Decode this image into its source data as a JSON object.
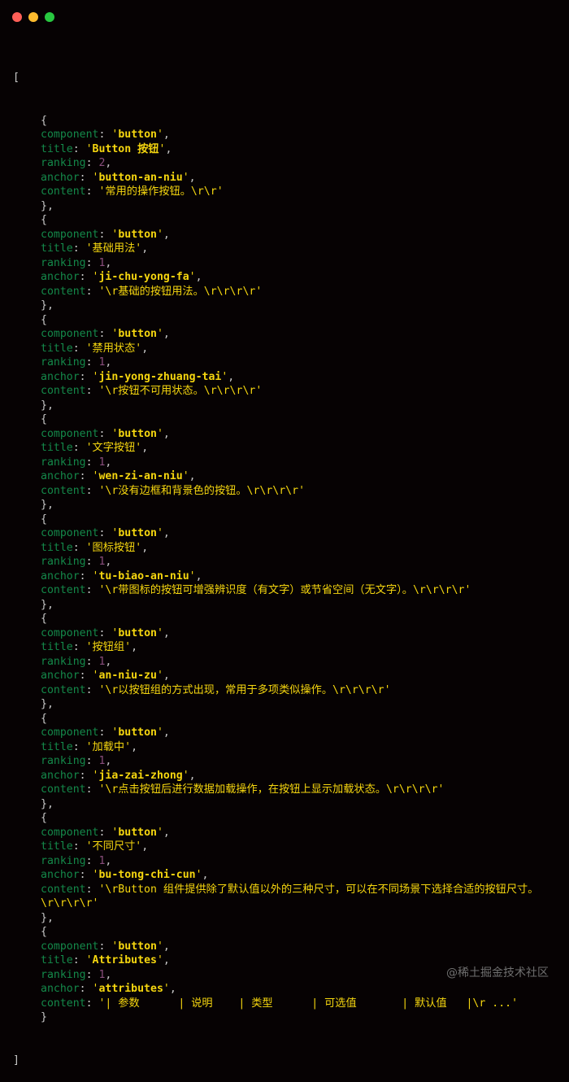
{
  "window": {
    "controls": [
      {
        "name": "close",
        "color": "#fe5f57"
      },
      {
        "name": "minimize",
        "color": "#febc2e"
      },
      {
        "name": "maximize",
        "color": "#28c840"
      }
    ]
  },
  "code": {
    "open_bracket": "[",
    "close_bracket": "]",
    "keys": {
      "component": "component",
      "title": "title",
      "ranking": "ranking",
      "anchor": "anchor",
      "content": "content"
    },
    "items": [
      {
        "component": "button",
        "title": "Button 按钮",
        "ranking": "2",
        "anchor": "button-an-niu",
        "content": "常用的操作按钮。\\r\\r"
      },
      {
        "component": "button",
        "title": "基础用法",
        "ranking": "1",
        "anchor": "ji-chu-yong-fa",
        "content": "\\r基础的按钮用法。\\r\\r\\r\\r"
      },
      {
        "component": "button",
        "title": "禁用状态",
        "ranking": "1",
        "anchor": "jin-yong-zhuang-tai",
        "content": "\\r按钮不可用状态。\\r\\r\\r\\r"
      },
      {
        "component": "button",
        "title": "文字按钮",
        "ranking": "1",
        "anchor": "wen-zi-an-niu",
        "content": "\\r没有边框和背景色的按钮。\\r\\r\\r\\r"
      },
      {
        "component": "button",
        "title": "图标按钮",
        "ranking": "1",
        "anchor": "tu-biao-an-niu",
        "content": "\\r带图标的按钮可增强辨识度（有文字）或节省空间（无文字）。\\r\\r\\r\\r"
      },
      {
        "component": "button",
        "title": "按钮组",
        "ranking": "1",
        "anchor": "an-niu-zu",
        "content": "\\r以按钮组的方式出现，常用于多项类似操作。\\r\\r\\r\\r"
      },
      {
        "component": "button",
        "title": "加载中",
        "ranking": "1",
        "anchor": "jia-zai-zhong",
        "content": "\\r点击按钮后进行数据加载操作，在按钮上显示加载状态。\\r\\r\\r\\r"
      },
      {
        "component": "button",
        "title": "不同尺寸",
        "ranking": "1",
        "anchor": "bu-tong-chi-cun",
        "content": "\\rButton 组件提供除了默认值以外的三种尺寸，可以在不同场景下选择合适的按钮尺寸。\\r\\r\\r\\r"
      },
      {
        "component": "button",
        "title": "Attributes",
        "ranking": "1",
        "anchor": "attributes",
        "content": "| 参数      | 说明    | 类型      | 可选值       | 默认值   |\\r ..."
      }
    ]
  },
  "watermark": "@稀土掘金技术社区",
  "colors": {
    "background": "#060203",
    "key": "#14894a",
    "string": "#f5d60f",
    "number": "#8a4f7d",
    "punctuation": "#c9c9c9"
  }
}
